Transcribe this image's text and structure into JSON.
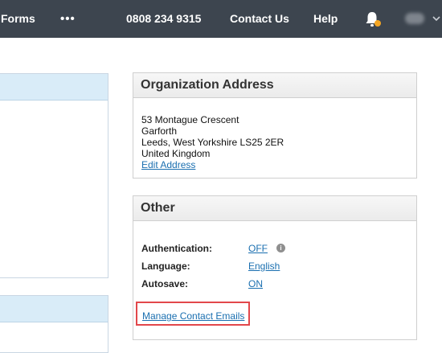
{
  "nav": {
    "forms": "Forms",
    "more": "•••",
    "phone": "0808 234 9315",
    "contact": "Contact Us",
    "help": "Help"
  },
  "icons": {
    "notification": "bell-icon",
    "more": "ellipsis-icon",
    "info": "info-icon",
    "dropdown": "chevron-down-icon"
  },
  "colors": {
    "topbar": "#3d454f",
    "notification_dot": "#f5a623",
    "link": "#1a6fb0",
    "highlight": "#e2474b"
  },
  "address_panel": {
    "title": "Organization Address",
    "lines": [
      "53 Montague Crescent",
      "Garforth",
      "Leeds, West Yorkshire LS25 2ER",
      "United Kingdom"
    ],
    "edit_link": "Edit Address"
  },
  "other_panel": {
    "title": "Other",
    "rows": [
      {
        "label": "Authentication:",
        "value": "OFF"
      },
      {
        "label": "Language:",
        "value": "English"
      },
      {
        "label": "Autosave:",
        "value": "ON"
      }
    ],
    "info_glyph": "i",
    "manage_link": "Manage Contact Emails"
  }
}
